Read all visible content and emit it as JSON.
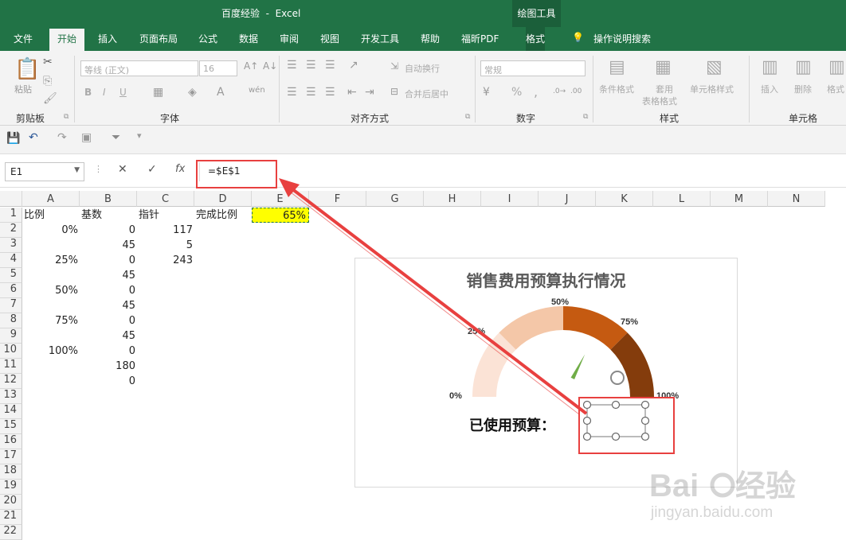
{
  "window": {
    "title": "百度经验  -  Excel",
    "context_tab": "绘图工具"
  },
  "tabs": [
    "文件",
    "开始",
    "插入",
    "页面布局",
    "公式",
    "数据",
    "审阅",
    "视图",
    "开发工具",
    "帮助",
    "福昕PDF",
    "格式"
  ],
  "tell_me": "操作说明搜索",
  "ribbon": {
    "clipboard": {
      "paste": "粘贴",
      "label": "剪贴板"
    },
    "font": {
      "name": "等线 (正文)",
      "size": "16",
      "bold": "B",
      "italic": "I",
      "underline": "U",
      "label": "字体"
    },
    "alignment": {
      "wrap": "自动换行",
      "merge": "合并后居中",
      "label": "对齐方式"
    },
    "number": {
      "format": "常规",
      "percent": "%",
      "comma": ",",
      "label": "数字"
    },
    "styles": {
      "conditional": "条件格式",
      "table1": "套用",
      "table2": "表格格式",
      "cell_styles": "单元格样式",
      "label": "样式"
    },
    "cells": {
      "insert": "插入",
      "delete": "删除",
      "format": "格式",
      "label": "单元格"
    }
  },
  "formula_bar": {
    "name_box": "E1",
    "formula": "=$E$1",
    "fx": "fx"
  },
  "columns": [
    "A",
    "B",
    "C",
    "D",
    "E",
    "F",
    "G",
    "H",
    "I",
    "J",
    "K",
    "L",
    "M",
    "N"
  ],
  "rows": [
    "1",
    "2",
    "3",
    "4",
    "5",
    "6",
    "7",
    "8",
    "9",
    "10",
    "11",
    "12",
    "13",
    "14",
    "15",
    "16",
    "17",
    "18",
    "19",
    "20",
    "21",
    "22"
  ],
  "cells": {
    "A1": "比例",
    "B1": "基数",
    "C1": "指针",
    "D1": "完成比例",
    "E1": "65%",
    "A2": "0%",
    "B2": "0",
    "C2": "117",
    "B3": "45",
    "C3": "5",
    "A4": "25%",
    "B4": "0",
    "C4": "243",
    "B5": "45",
    "A6": "50%",
    "B6": "0",
    "B7": "45",
    "A8": "75%",
    "B8": "0",
    "B9": "45",
    "A10": "100%",
    "B10": "0",
    "B11": "180",
    "B12": "0"
  },
  "chart": {
    "title": "销售费用预算执行情况",
    "labels": [
      "0%",
      "25%",
      "50%",
      "75%",
      "100%"
    ],
    "caption": "已使用预算：",
    "needle_value": 0.65,
    "colors": {
      "seg1": "#fbe3d6",
      "seg2": "#f4c7a8",
      "seg3": "#c55a11",
      "seg4": "#843c0c",
      "needle": "#70ad47"
    }
  },
  "colors": {
    "accent": "#217346",
    "highlight": "#ffff00",
    "annotation": "#e8403f"
  },
  "watermark": {
    "logo": "Baidu经验",
    "url": "jingyan.baidu.com"
  }
}
